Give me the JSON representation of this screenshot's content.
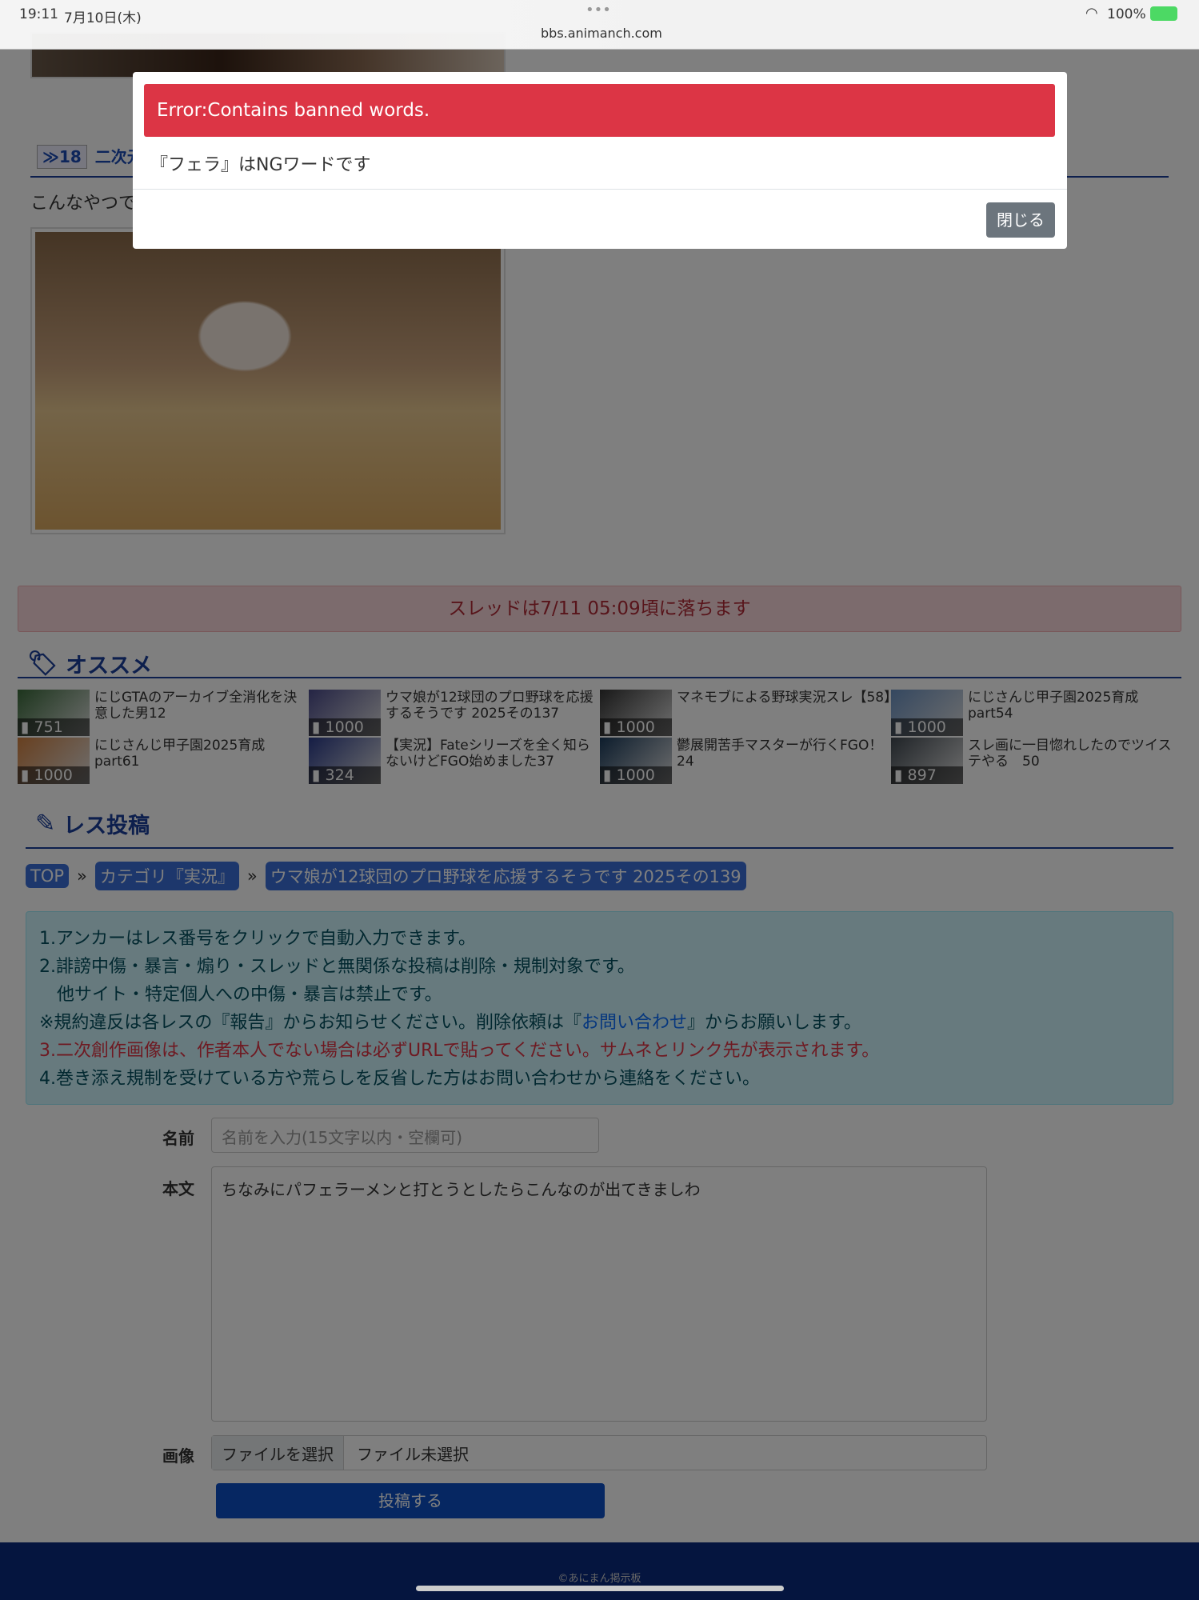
{
  "status_bar": {
    "time": "19:11",
    "date": "7月10日(木)",
    "url": "bbs.animanch.com",
    "battery": "100%"
  },
  "post": {
    "anchor": "≫18",
    "title": "二次元",
    "body": "こんなやつで"
  },
  "thread_notice": "スレッドは7/11 05:09頃に落ちます",
  "recommend": {
    "heading": "オススメ",
    "items": [
      {
        "title": "にじGTAのアーカイブ全消化を決意した男12",
        "count": "751"
      },
      {
        "title": "ウマ娘が12球団のプロ野球を応援するそうです 2025その137",
        "count": "1000"
      },
      {
        "title": "マネモブによる野球実況スレ【58】",
        "count": "1000"
      },
      {
        "title": "にじさんじ甲子園2025育成part54",
        "count": "1000"
      },
      {
        "title": "にじさんじ甲子園2025育成part61",
        "count": "1000"
      },
      {
        "title": "【実況】Fateシリーズを全く知らないけどFGO始めました37",
        "count": "324"
      },
      {
        "title": "鬱展開苦手マスターが行くFGO！24",
        "count": "1000"
      },
      {
        "title": "スレ画に一目惚れしたのでツイステやる　50",
        "count": "897"
      }
    ]
  },
  "reply": {
    "heading": "レス投稿",
    "breadcrumb": [
      "TOP",
      "カテゴリ『実況』",
      "ウマ娘が12球団のプロ野球を応援するそうです 2025その139"
    ],
    "sep": "»",
    "rules": {
      "r1": "1.アンカーはレス番号をクリックで自動入力できます。",
      "r2": "2.誹謗中傷・暴言・煽り・スレッドと無関係な投稿は削除・規制対象です。",
      "r2b": "　他サイト・特定個人への中傷・暴言は禁止です。",
      "r3a": "※規約違反は各レスの『報告』からお知らせください。削除依頼は『",
      "r3link": "お問い合わせ",
      "r3b": "』からお願いします。",
      "r4": "3.二次創作画像は、作者本人でない場合は必ずURLで貼ってください。サムネとリンク先が表示されます。",
      "r5": "4.巻き添え規制を受けている方や荒らしを反省した方はお問い合わせから連絡をください。"
    },
    "name_label": "名前",
    "name_placeholder": "名前を入力(15文字以内・空欄可)",
    "body_label": "本文",
    "body_value": "ちなみにパフェラーメンと打とうとしたらこんなのが出てきましわ",
    "image_label": "画像",
    "file_button": "ファイルを選択",
    "file_status": "ファイル未選択",
    "submit": "投稿する"
  },
  "footer": "©あにまん掲示板",
  "modal": {
    "error": "Error:Contains banned words.",
    "message": "『フェラ』はNGワードです",
    "close": "閉じる"
  }
}
